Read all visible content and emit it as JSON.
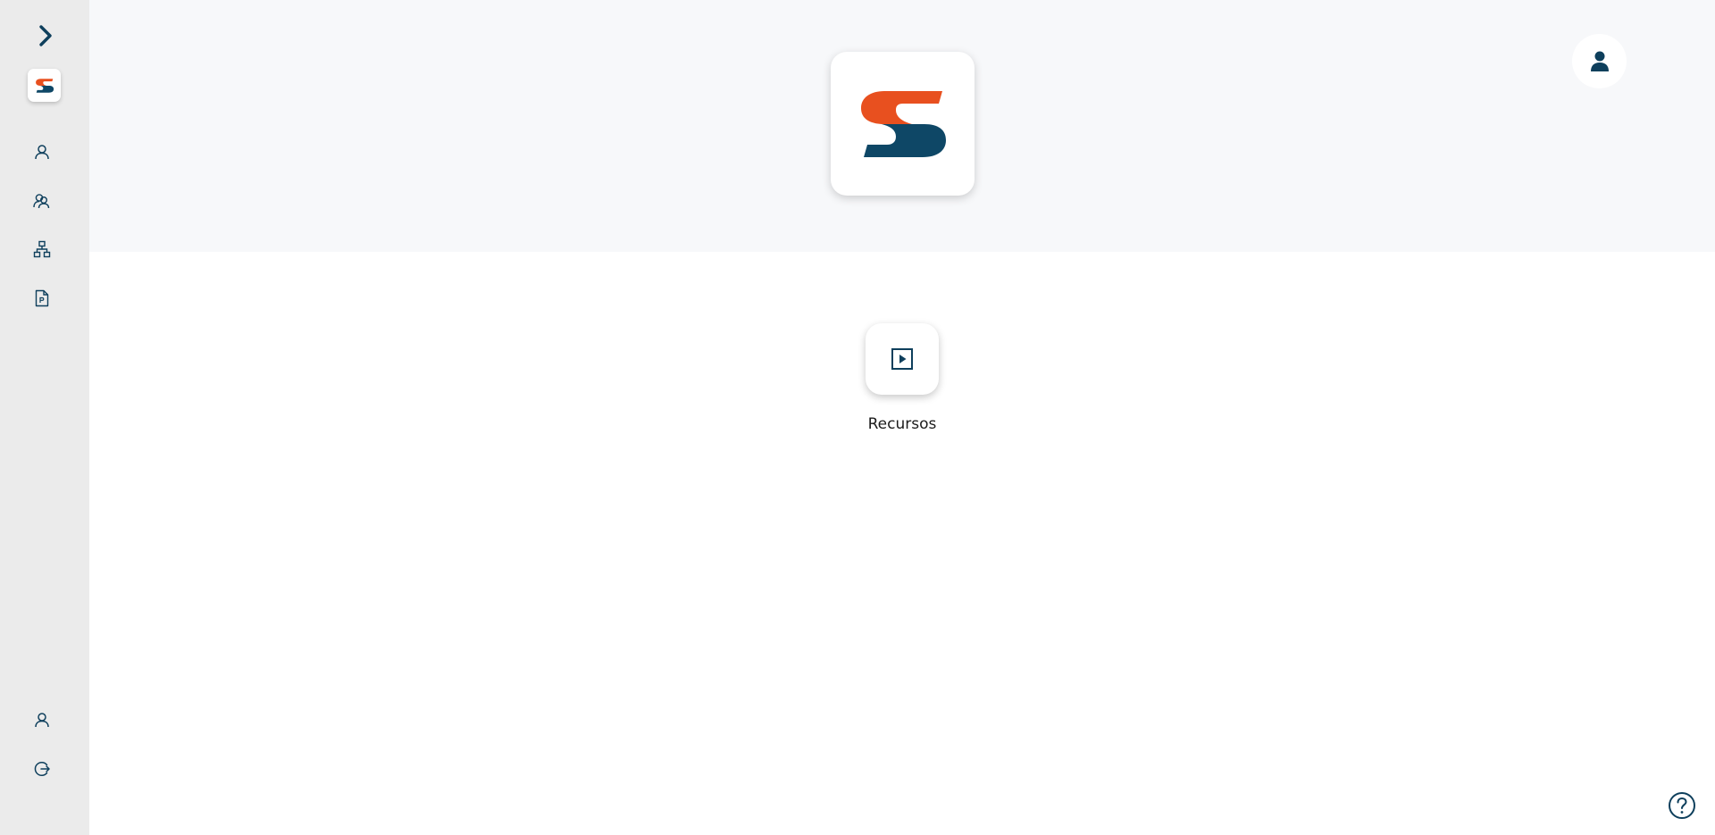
{
  "app": {
    "brand_colors": {
      "navy": "#0e4766",
      "orange": "#e8501f"
    }
  },
  "sidebar": {
    "expand_icon": "chevron-right-icon",
    "logo_icon": "s-logo",
    "items": [
      {
        "icon": "user-icon"
      },
      {
        "icon": "users-icon"
      },
      {
        "icon": "org-chart-icon"
      },
      {
        "icon": "document-icon"
      }
    ],
    "bottom_items": [
      {
        "icon": "profile-icon"
      },
      {
        "icon": "logout-icon"
      }
    ]
  },
  "header": {
    "logo_icon": "s-logo",
    "avatar_icon": "user-solid-icon",
    "collapse_icon": "chevron-left-icon"
  },
  "main": {
    "tiles": [
      {
        "label": "Recursos",
        "icon": "play-square-icon"
      }
    ]
  },
  "help": {
    "icon": "help-circle-icon"
  }
}
